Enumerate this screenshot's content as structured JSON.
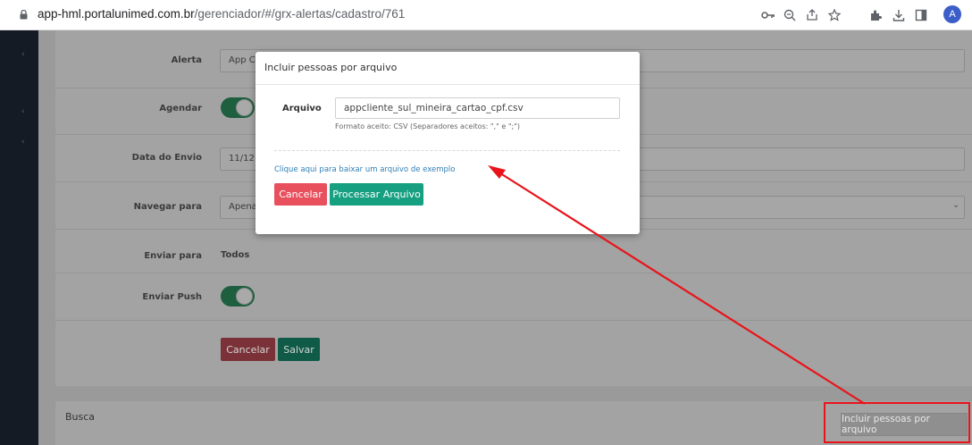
{
  "browser": {
    "url_host": "app-hml.portalunimed.com.br",
    "url_path": "/gerenciador/#/grx-alertas/cadastro/761",
    "avatar_letter": "A",
    "icons": [
      "key-icon",
      "zoom-icon",
      "share-icon",
      "star-icon",
      "extensions-icon",
      "download-icon",
      "sidepanel-icon"
    ]
  },
  "form": {
    "alerta": {
      "label": "Alerta",
      "value": "App C"
    },
    "agendar": {
      "label": "Agendar"
    },
    "data_envio": {
      "label": "Data do Envio",
      "value": "11/12"
    },
    "navegar_para": {
      "label": "Navegar para",
      "value": "Apena"
    },
    "enviar_para": {
      "label": "Enviar para",
      "value": "Todos"
    },
    "enviar_push": {
      "label": "Enviar Push"
    },
    "cancel_label": "Cancelar",
    "save_label": "Salvar"
  },
  "busca": {
    "title": "Busca",
    "incluir_button": "Incluir pessoas por arquivo"
  },
  "modal": {
    "title": "Incluir pessoas por arquivo",
    "file_label": "Arquivo",
    "file_value": "appcliente_sul_mineira_cartao_cpf.csv",
    "help_text": "Formato aceito: CSV (Separadores aceitos: \",\" e \";\")",
    "example_link": "Clique aqui para baixar um arquivo de exemplo",
    "cancel_label": "Cancelar",
    "process_label": "Processar Arquivo"
  },
  "colors": {
    "annotation": "#e8141a",
    "danger": "#e8505e",
    "success": "#16a081",
    "link": "#2f7fb5"
  }
}
